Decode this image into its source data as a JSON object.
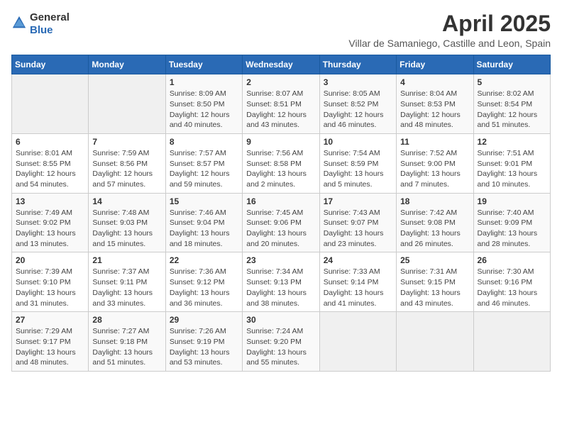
{
  "logo": {
    "general": "General",
    "blue": "Blue"
  },
  "title": "April 2025",
  "subtitle": "Villar de Samaniego, Castille and Leon, Spain",
  "weekdays": [
    "Sunday",
    "Monday",
    "Tuesday",
    "Wednesday",
    "Thursday",
    "Friday",
    "Saturday"
  ],
  "weeks": [
    [
      {
        "day": "",
        "info": ""
      },
      {
        "day": "",
        "info": ""
      },
      {
        "day": "1",
        "info": "Sunrise: 8:09 AM\nSunset: 8:50 PM\nDaylight: 12 hours and 40 minutes."
      },
      {
        "day": "2",
        "info": "Sunrise: 8:07 AM\nSunset: 8:51 PM\nDaylight: 12 hours and 43 minutes."
      },
      {
        "day": "3",
        "info": "Sunrise: 8:05 AM\nSunset: 8:52 PM\nDaylight: 12 hours and 46 minutes."
      },
      {
        "day": "4",
        "info": "Sunrise: 8:04 AM\nSunset: 8:53 PM\nDaylight: 12 hours and 48 minutes."
      },
      {
        "day": "5",
        "info": "Sunrise: 8:02 AM\nSunset: 8:54 PM\nDaylight: 12 hours and 51 minutes."
      }
    ],
    [
      {
        "day": "6",
        "info": "Sunrise: 8:01 AM\nSunset: 8:55 PM\nDaylight: 12 hours and 54 minutes."
      },
      {
        "day": "7",
        "info": "Sunrise: 7:59 AM\nSunset: 8:56 PM\nDaylight: 12 hours and 57 minutes."
      },
      {
        "day": "8",
        "info": "Sunrise: 7:57 AM\nSunset: 8:57 PM\nDaylight: 12 hours and 59 minutes."
      },
      {
        "day": "9",
        "info": "Sunrise: 7:56 AM\nSunset: 8:58 PM\nDaylight: 13 hours and 2 minutes."
      },
      {
        "day": "10",
        "info": "Sunrise: 7:54 AM\nSunset: 8:59 PM\nDaylight: 13 hours and 5 minutes."
      },
      {
        "day": "11",
        "info": "Sunrise: 7:52 AM\nSunset: 9:00 PM\nDaylight: 13 hours and 7 minutes."
      },
      {
        "day": "12",
        "info": "Sunrise: 7:51 AM\nSunset: 9:01 PM\nDaylight: 13 hours and 10 minutes."
      }
    ],
    [
      {
        "day": "13",
        "info": "Sunrise: 7:49 AM\nSunset: 9:02 PM\nDaylight: 13 hours and 13 minutes."
      },
      {
        "day": "14",
        "info": "Sunrise: 7:48 AM\nSunset: 9:03 PM\nDaylight: 13 hours and 15 minutes."
      },
      {
        "day": "15",
        "info": "Sunrise: 7:46 AM\nSunset: 9:04 PM\nDaylight: 13 hours and 18 minutes."
      },
      {
        "day": "16",
        "info": "Sunrise: 7:45 AM\nSunset: 9:06 PM\nDaylight: 13 hours and 20 minutes."
      },
      {
        "day": "17",
        "info": "Sunrise: 7:43 AM\nSunset: 9:07 PM\nDaylight: 13 hours and 23 minutes."
      },
      {
        "day": "18",
        "info": "Sunrise: 7:42 AM\nSunset: 9:08 PM\nDaylight: 13 hours and 26 minutes."
      },
      {
        "day": "19",
        "info": "Sunrise: 7:40 AM\nSunset: 9:09 PM\nDaylight: 13 hours and 28 minutes."
      }
    ],
    [
      {
        "day": "20",
        "info": "Sunrise: 7:39 AM\nSunset: 9:10 PM\nDaylight: 13 hours and 31 minutes."
      },
      {
        "day": "21",
        "info": "Sunrise: 7:37 AM\nSunset: 9:11 PM\nDaylight: 13 hours and 33 minutes."
      },
      {
        "day": "22",
        "info": "Sunrise: 7:36 AM\nSunset: 9:12 PM\nDaylight: 13 hours and 36 minutes."
      },
      {
        "day": "23",
        "info": "Sunrise: 7:34 AM\nSunset: 9:13 PM\nDaylight: 13 hours and 38 minutes."
      },
      {
        "day": "24",
        "info": "Sunrise: 7:33 AM\nSunset: 9:14 PM\nDaylight: 13 hours and 41 minutes."
      },
      {
        "day": "25",
        "info": "Sunrise: 7:31 AM\nSunset: 9:15 PM\nDaylight: 13 hours and 43 minutes."
      },
      {
        "day": "26",
        "info": "Sunrise: 7:30 AM\nSunset: 9:16 PM\nDaylight: 13 hours and 46 minutes."
      }
    ],
    [
      {
        "day": "27",
        "info": "Sunrise: 7:29 AM\nSunset: 9:17 PM\nDaylight: 13 hours and 48 minutes."
      },
      {
        "day": "28",
        "info": "Sunrise: 7:27 AM\nSunset: 9:18 PM\nDaylight: 13 hours and 51 minutes."
      },
      {
        "day": "29",
        "info": "Sunrise: 7:26 AM\nSunset: 9:19 PM\nDaylight: 13 hours and 53 minutes."
      },
      {
        "day": "30",
        "info": "Sunrise: 7:24 AM\nSunset: 9:20 PM\nDaylight: 13 hours and 55 minutes."
      },
      {
        "day": "",
        "info": ""
      },
      {
        "day": "",
        "info": ""
      },
      {
        "day": "",
        "info": ""
      }
    ]
  ]
}
